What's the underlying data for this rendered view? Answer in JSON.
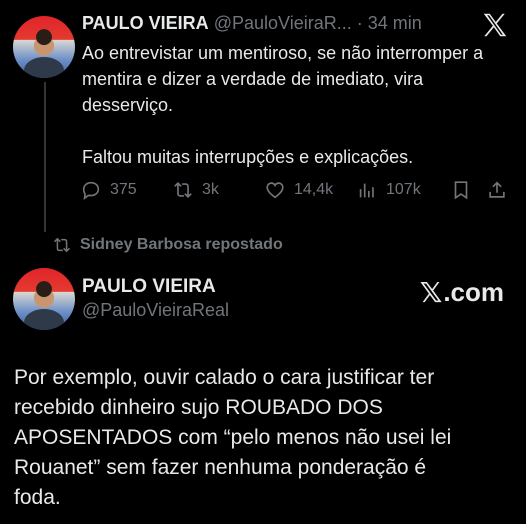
{
  "tweet": {
    "author_name": "PAULO VIEIRA",
    "author_handle": "@PauloVieiraR...",
    "separator": "·",
    "time": "34 min",
    "text_paragraphs": [
      "Ao entrevistar um mentiroso, se não interromper a mentira e dizer a verdade de imediato, vira desserviço.",
      "Faltou muitas interrupções e explicações."
    ],
    "stats": {
      "replies": "375",
      "reposts": "3k",
      "likes": "14,4k",
      "views": "107k"
    }
  },
  "repost_banner": {
    "label": "Sidney Barbosa repostado"
  },
  "embedded_tweet": {
    "author_name": "PAULO VIEIRA",
    "author_handle": "@PauloVieiraReal",
    "brand": "X.com",
    "brand_mark": "𝕏",
    "brand_suffix": ".com",
    "text_lines": [
      "Por exemplo, ouvir calado o cara justificar ter",
      "recebido dinheiro sujo ROUBADO DOS",
      "APOSENTADOS  com “pelo menos não usei lei",
      "Rouanet” sem fazer nenhuma ponderação é",
      "foda."
    ]
  },
  "icons": {
    "top_right": "x-close-icon",
    "reply": "reply-icon",
    "repost": "repost-icon",
    "like": "heart-icon",
    "views": "views-icon",
    "bookmark": "bookmark-icon",
    "share": "share-icon"
  },
  "colors": {
    "background": "#000000",
    "primary_text": "#e7e9ea",
    "secondary_text": "#71767b"
  }
}
